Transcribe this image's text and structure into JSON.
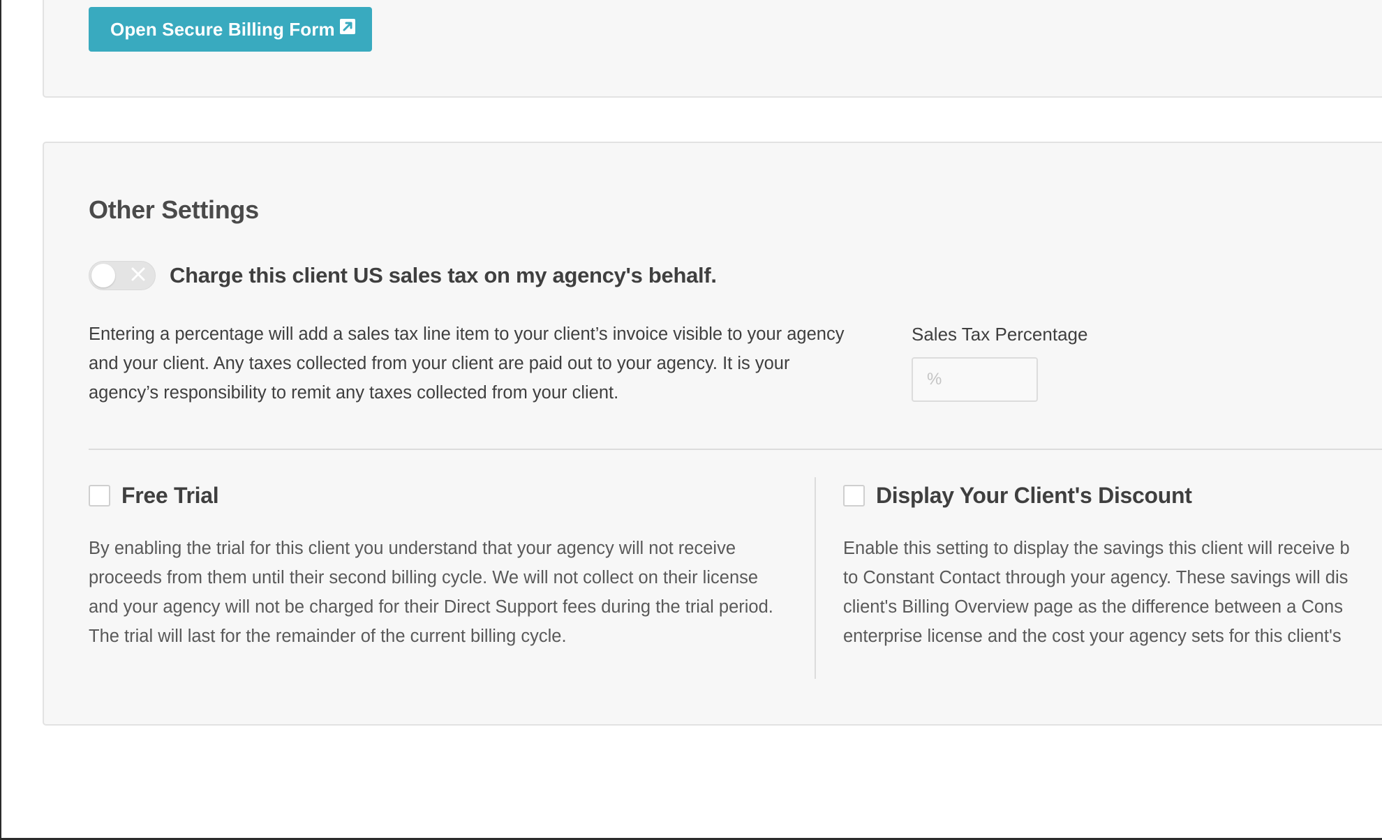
{
  "billing": {
    "button_label": "Open Secure Billing Form",
    "button_icon": "external-link-icon"
  },
  "other_settings": {
    "title": "Other Settings",
    "sales_tax": {
      "toggle_label": "Charge this client US sales tax on my agency's behalf.",
      "toggle_state": "off",
      "description": "Entering a percentage will add a sales tax line item to your client’s invoice visible to your agency and your client. Any taxes collected from your client are paid out to your agency. It is your agency’s responsibility to remit any taxes collected from your client.",
      "field_label": "Sales Tax Percentage",
      "field_value": "",
      "field_placeholder": "%"
    },
    "free_trial": {
      "label": "Free Trial",
      "checked": false,
      "description": "By enabling the trial for this client you understand that your agency will not receive proceeds from them until their second billing cycle. We will not collect on their license and your agency will not be charged for their Direct Support fees during the trial period. The trial will last for the remainder of the current billing cycle."
    },
    "display_discount": {
      "label": "Display Your Client's Discount",
      "checked": false,
      "description_lines": [
        "Enable this setting to display the savings this client will receive b",
        "to Constant Contact through your agency. These savings will dis",
        "client's Billing Overview page as the difference between a Cons",
        "enterprise license and the cost your agency sets for this client's"
      ]
    }
  },
  "colors": {
    "accent": "#39aabf",
    "panel_bg": "#f7f7f7",
    "border": "#e2e2e2",
    "text": "#3f3f3f"
  }
}
